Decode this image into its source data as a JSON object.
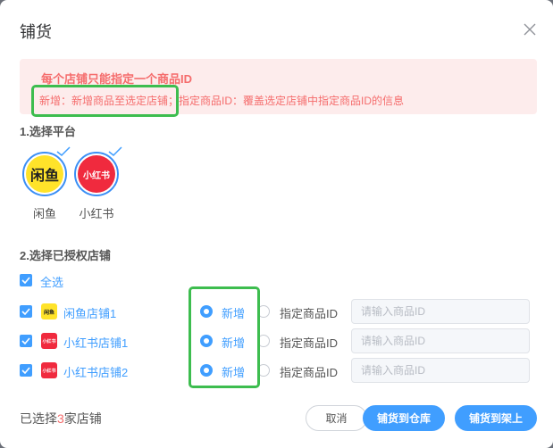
{
  "dialog": {
    "title": "铺货"
  },
  "alert": {
    "title": "每个店铺只能指定一个商品ID",
    "desc_prefix": "新增：新增商品至选定店铺；",
    "desc_suffix": "指定商品ID：覆盖选定店铺中指定商品ID的信息"
  },
  "platform_section": {
    "title": "1.选择平台",
    "items": [
      {
        "name": "闲鱼",
        "logo_text": "闲鱼",
        "logo_bg": "#ffe32a",
        "logo_fg": "#222222"
      },
      {
        "name": "小红书",
        "logo_text": "小红书",
        "logo_bg": "#f02a3e",
        "logo_fg": "#ffffff"
      }
    ]
  },
  "shop_section": {
    "title": "2.选择已授权店铺",
    "select_all": "全选",
    "option_new": "新增",
    "option_specify": "指定商品ID",
    "input_placeholder": "请输入商品ID",
    "shops": [
      {
        "name": "闲鱼店铺1",
        "icon_text": "闲鱼",
        "icon_bg": "#ffe32a",
        "icon_fg": "#222222",
        "new_selected": true
      },
      {
        "name": "小红书店铺1",
        "icon_text": "小红书",
        "icon_bg": "#f02a3e",
        "icon_fg": "#ffffff",
        "new_selected": true
      },
      {
        "name": "小红书店铺2",
        "icon_text": "小红书",
        "icon_bg": "#f02a3e",
        "icon_fg": "#ffffff",
        "new_selected": true
      }
    ]
  },
  "footer": {
    "selected_prefix": "已选择",
    "selected_count": "3",
    "selected_suffix": "家店铺",
    "cancel": "取消",
    "to_warehouse": "铺货到仓库",
    "to_shelf": "铺货到架上"
  },
  "colors": {
    "primary": "#409eff",
    "danger": "#f56c6c",
    "highlight": "#3dbd4f"
  }
}
